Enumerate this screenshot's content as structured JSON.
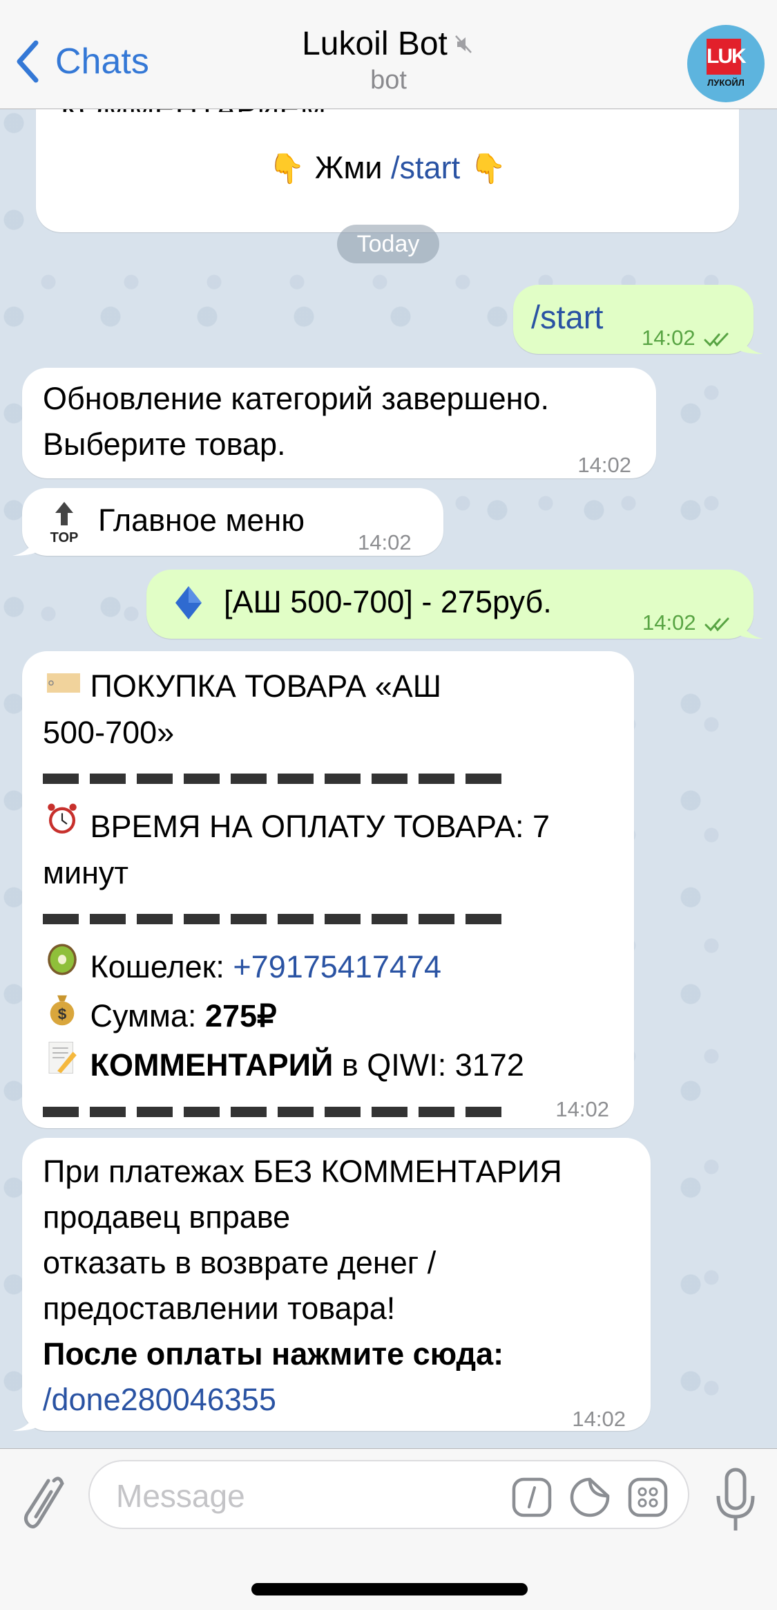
{
  "header": {
    "back_label": "Chats",
    "title": "Lukoil Bot",
    "subtitle": "bot",
    "avatar_logo": "LUK",
    "avatar_text": "ЛУКОЙЛ"
  },
  "messages": {
    "m0": {
      "partial_text": "КОММЕНТАРИЕМ.",
      "press_text": "Жми",
      "press_link": "/start",
      "emoji_left": "👇",
      "emoji_right": "👇"
    },
    "date_separator": "Today",
    "m1": {
      "text": "/start",
      "time": "14:02",
      "status": "read"
    },
    "m2": {
      "line1": "Обновление категорий завершено.",
      "line2": "Выберите товар.",
      "time": "14:02"
    },
    "m3": {
      "emoji": "🔝",
      "text": "Главное меню",
      "time": "14:02"
    },
    "m4": {
      "emoji": "🔷",
      "text": "[АШ 500-700] - 275руб.",
      "time": "14:02",
      "status": "read"
    },
    "m5": {
      "line1_emoji": "🏷️",
      "line1": "ПОКУПКА ТОВАРА  «АШ",
      "line2": "500-700»",
      "time_emoji": "⏰",
      "time_line1": "ВРЕМЯ НА ОПЛАТУ ТОВАРА: 7",
      "time_line2": "минут",
      "wallet_emoji": "🥝",
      "wallet_label": "Кошелек:",
      "wallet_value": "+79175417474",
      "sum_emoji": "💰",
      "sum_label": "Сумма:",
      "sum_value": "275₽",
      "comment_emoji": "📝",
      "comment_bold": "КОММЕНТАРИЙ",
      "comment_rest": "в QIWI: 3172",
      "time": "14:02"
    },
    "m6": {
      "line1": "При платежах БЕЗ КОММЕНТАРИЯ",
      "line2": "продавец вправе",
      "line3": "отказать в возврате денег /",
      "line4": "предоставлении товара!",
      "line5_bold": "После оплаты нажмите сюда:",
      "link": "/done280046355",
      "time": "14:02"
    }
  },
  "input": {
    "placeholder": "Message",
    "value": ""
  },
  "icons": {
    "back": "chevron-left-icon",
    "mute": "muted-speaker-icon",
    "attach": "paperclip-icon",
    "commands": "slash-command-icon",
    "sticker": "sticker-icon",
    "keyboard": "bot-keyboard-icon",
    "mic": "microphone-icon"
  },
  "colors": {
    "accent": "#3478d6",
    "link": "#2a53a3",
    "outgoing_bubble": "#e1fec6",
    "outgoing_time": "#58a443",
    "chat_background": "#d8e2ec"
  }
}
